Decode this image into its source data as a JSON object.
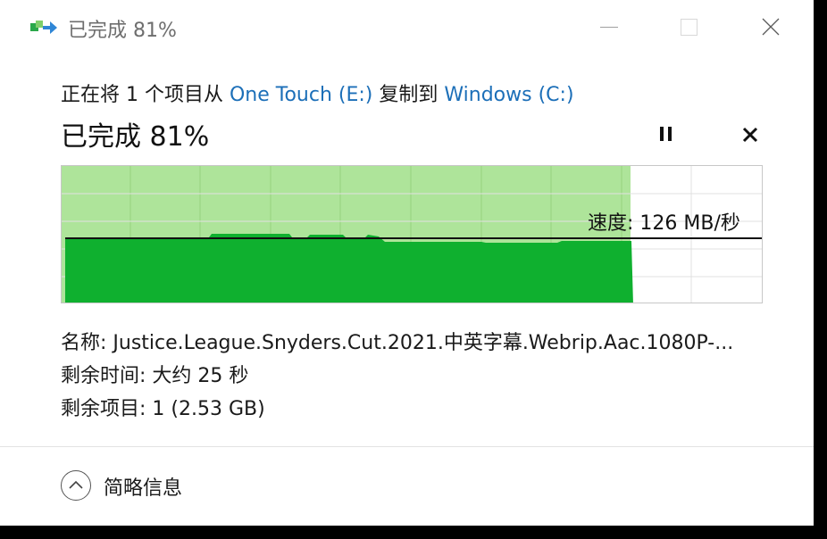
{
  "window": {
    "title": "已完成 81%",
    "title_icon": "copy-progress-icon"
  },
  "header": {
    "copy_prefix": "正在将 1 个项目从 ",
    "source": "One Touch (E:)",
    "copy_middle": " 复制到 ",
    "destination": "Windows (C:)",
    "progress_text": "已完成 81%",
    "progress_percent": 81
  },
  "controls": {
    "pause_icon": "pause-icon",
    "cancel_icon": "close-icon"
  },
  "graph": {
    "speed_label": "速度: 126 MB/秒",
    "fill_color": "#0fb02f",
    "light_fill_color": "#aee49a"
  },
  "details": {
    "name": "名称: Justice.League.Snyders.Cut.2021.中英字幕.Webrip.Aac.1080P-...",
    "time_remaining": "剩余时间: 大约 25 秒",
    "items_remaining": "剩余项目: 1 (2.53 GB)"
  },
  "footer": {
    "toggle_label": "简略信息",
    "toggle_icon": "chevron-up-icon"
  }
}
